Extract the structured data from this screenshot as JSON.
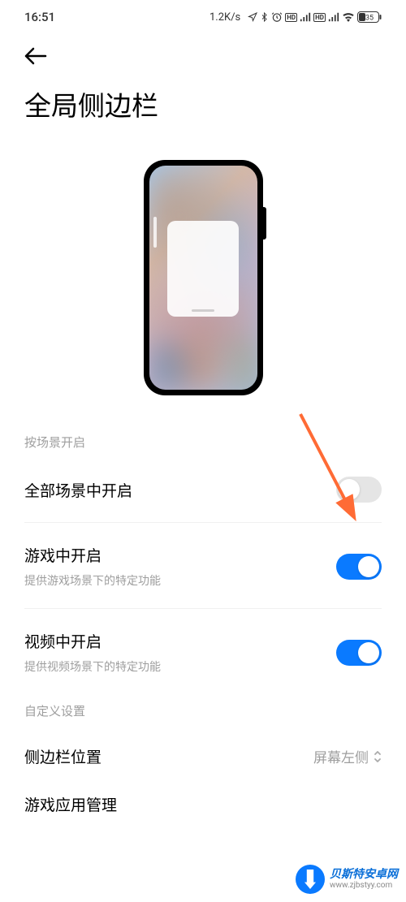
{
  "statusBar": {
    "time": "16:51",
    "speed": "1.2K/s",
    "battery": "35"
  },
  "pageTitle": "全局侧边栏",
  "sections": {
    "scene": {
      "label": "按场景开启",
      "items": [
        {
          "title": "全部场景中开启",
          "subtitle": "",
          "enabled": false
        },
        {
          "title": "游戏中开启",
          "subtitle": "提供游戏场景下的特定功能",
          "enabled": true
        },
        {
          "title": "视频中开启",
          "subtitle": "提供视频场景下的特定功能",
          "enabled": true
        }
      ]
    },
    "custom": {
      "label": "自定义设置",
      "positionSetting": {
        "title": "侧边栏位置",
        "value": "屏幕左侧"
      },
      "appManagement": {
        "title": "游戏应用管理"
      }
    }
  },
  "watermark": {
    "title": "贝斯特安卓网",
    "url": "www.zjbstyy.com"
  }
}
